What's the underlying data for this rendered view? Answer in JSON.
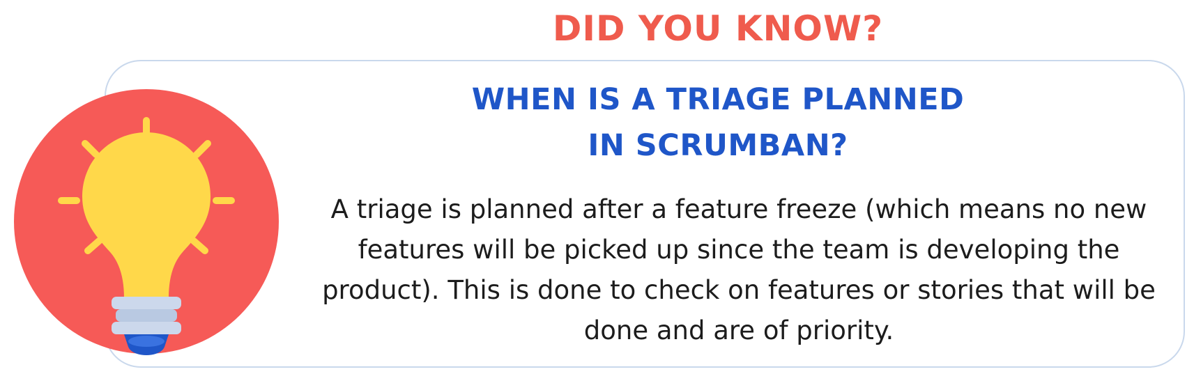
{
  "eyebrow": {
    "text": "DID YOU KNOW?",
    "color": "#ef5b4d"
  },
  "heading": {
    "line1": "WHEN IS A TRIAGE PLANNED",
    "line2": "IN SCRUMBAN?",
    "color": "#1f56c8"
  },
  "body": {
    "text": "A triage is planned after a feature freeze (which means no new features will be picked up since the team is developing the product). This is done to check on features or stories that will be done and are of priority."
  },
  "icon": {
    "name": "lightbulb-icon",
    "circle_color": "#f65a57",
    "bulb_color": "#ffd84a",
    "base_color": "#ccd8ec",
    "tip_color": "#1f56c8"
  }
}
